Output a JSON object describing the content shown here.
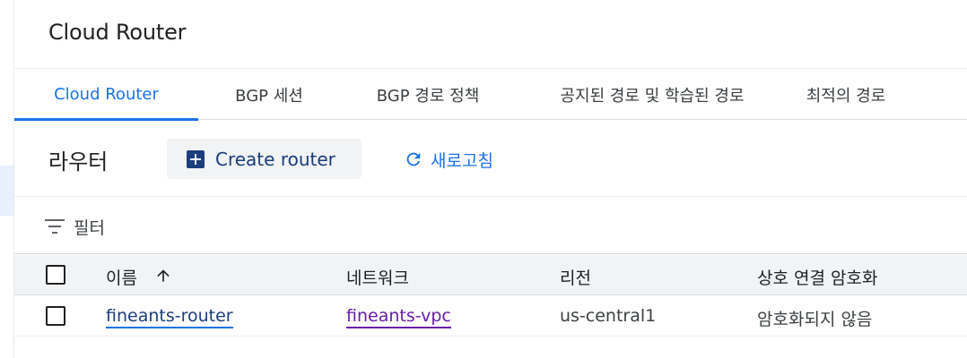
{
  "page": {
    "title": "Cloud Router"
  },
  "tabs": [
    {
      "label": "Cloud Router",
      "active": true
    },
    {
      "label": "BGP 세션",
      "active": false
    },
    {
      "label": "BGP 경로 정책",
      "active": false
    },
    {
      "label": "공지된 경로 및 학습된 경로",
      "active": false
    },
    {
      "label": "최적의 경로",
      "active": false
    }
  ],
  "toolbar": {
    "section_title": "라우터",
    "create_label": "Create router",
    "refresh_label": "새로고침"
  },
  "filter": {
    "label": "필터"
  },
  "table": {
    "columns": [
      "이름",
      "네트워크",
      "리전",
      "상호 연결 암호화"
    ],
    "rows": [
      {
        "name": "fineants-router",
        "network": "fineants-vpc",
        "region": "us-central1",
        "encryption": "암호화되지 않음"
      }
    ]
  },
  "colors": {
    "accent": "#1a73e8",
    "create_button_text": "#1a3d7c",
    "visited_link": "#681da8"
  },
  "icons": [
    "plus-box-icon",
    "refresh-icon",
    "filter-icon",
    "sort-ascending-icon",
    "checkbox-icon"
  ]
}
